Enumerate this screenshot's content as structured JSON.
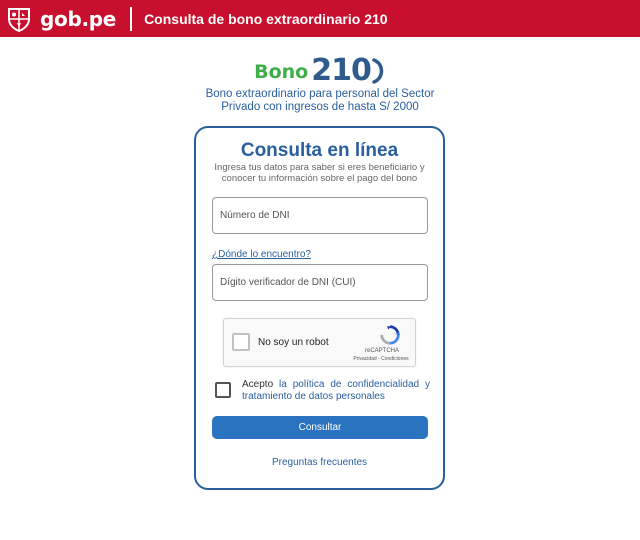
{
  "header": {
    "logo_text": "gob.pe",
    "title": "Consulta de bono extraordinario 210",
    "background_color": "#c8102e"
  },
  "brand": {
    "bono_word": "Bono",
    "bono_number": "210",
    "subtitle_line1": "Bono extraordinario para personal del Sector",
    "subtitle_line2": "Privado con ingresos de hasta S/ 2000",
    "green": "#3fae49",
    "blue": "#2e5a8c"
  },
  "form": {
    "title": "Consulta en línea",
    "description": "Ingresa tus datos para saber si eres beneficiario y conocer tu información sobre el pago del bono",
    "dni_placeholder": "Número de DNI",
    "dni_value": "",
    "help_link": "¿Dónde lo encuentro?",
    "cui_placeholder": "Dígito verificador de DNI (CUI)",
    "cui_value": "",
    "captcha": {
      "label": "No soy un robot",
      "brand": "reCAPTCHA",
      "links": "Privacidad - Condiciones",
      "icon": "recaptcha-icon"
    },
    "terms": {
      "prefix": "Acepto ",
      "link": "la política de confidencialidad y tratamiento de datos personales",
      "checked": false
    },
    "submit_label": "Consultar",
    "faq_link": "Preguntas frecuentes",
    "accent_color": "#2a73c0"
  }
}
